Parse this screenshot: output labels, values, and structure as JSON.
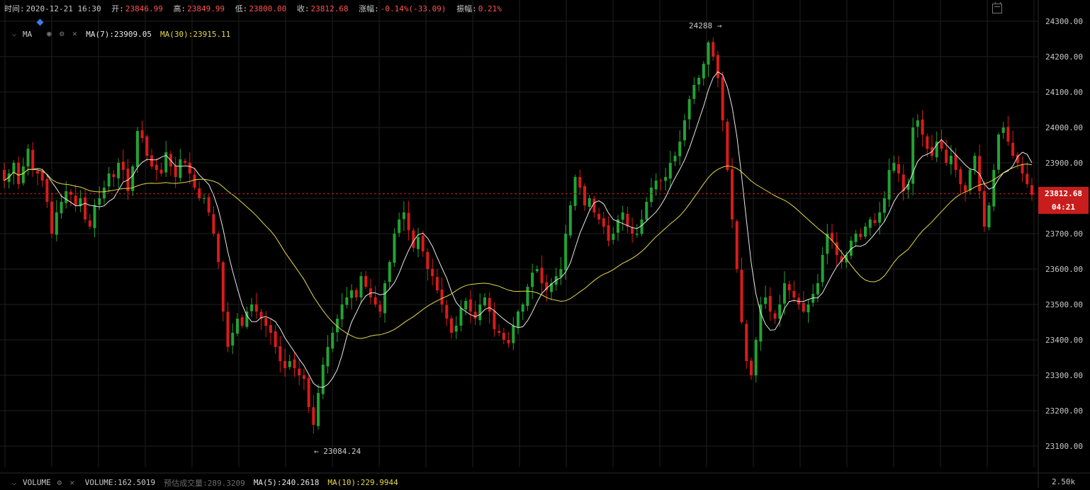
{
  "header": {
    "time_label": "时间:",
    "time_value": "2020-12-21 16:30",
    "open_label": "开:",
    "open_value": "23846.99",
    "high_label": "高:",
    "high_value": "23849.99",
    "low_label": "低:",
    "low_value": "23800.00",
    "close_label": "收:",
    "close_value": "23812.68",
    "change_label": "涨幅:",
    "change_value": "-0.14%(-33.09)",
    "amplitude_label": "振幅:",
    "amplitude_value": "0.21%"
  },
  "ma_indicator": {
    "name": "MA",
    "ma7_label": "MA(7):23909.05",
    "ma30_label": "MA(30):23915.11"
  },
  "volume_indicator": {
    "name": "VOLUME",
    "volume_label": "VOLUME:162.5019",
    "estimate_label": "预估成交量:289.3209",
    "ma5_label": "MA(5):240.2618",
    "ma10_label": "MA(10):229.9944"
  },
  "price_tag": {
    "price": "23812.68",
    "countdown": "04:21"
  },
  "annotations": {
    "high_marker": "24288 →",
    "low_marker": "← 23084.24"
  },
  "colors": {
    "up": "#21a334",
    "down": "#d91b1b",
    "ma7": "#e8e8e8",
    "ma30": "#e6d84a",
    "grid": "#1f1f1f",
    "last_price_line": "#c91d1d"
  },
  "icons": {
    "collapse": "chevron-down-icon",
    "visibility": "eye-icon",
    "settings": "gear-icon",
    "close": "close-icon",
    "calendar": "calendar-icon"
  },
  "chart_data": {
    "type": "candlestick",
    "y_axis_ticks": [
      "24300.00",
      "24200.00",
      "24100.00",
      "24000.00",
      "23900.00",
      "23800.00",
      "23700.00",
      "23600.00",
      "23500.00",
      "23400.00",
      "23300.00",
      "23200.00",
      "23100.00"
    ],
    "y_axis_values": [
      24300,
      24200,
      24100,
      24000,
      23900,
      23800,
      23700,
      23600,
      23500,
      23400,
      23300,
      23200,
      23100
    ],
    "volume_axis_tick": "2.50k",
    "ylim": [
      23047,
      24311
    ],
    "last_price": 23812.68,
    "closes": [
      23850,
      23870,
      23900,
      23840,
      23890,
      23940,
      23880,
      23870,
      23850,
      23790,
      23700,
      23760,
      23790,
      23820,
      23810,
      23780,
      23800,
      23740,
      23720,
      23780,
      23800,
      23830,
      23870,
      23860,
      23900,
      23880,
      23820,
      23890,
      23990,
      23970,
      23920,
      23890,
      23880,
      23870,
      23930,
      23890,
      23860,
      23910,
      23900,
      23870,
      23830,
      23800,
      23800,
      23760,
      23700,
      23620,
      23480,
      23380,
      23420,
      23460,
      23440,
      23480,
      23500,
      23480,
      23460,
      23440,
      23420,
      23380,
      23340,
      23320,
      23340,
      23320,
      23300,
      23290,
      23210,
      23160,
      23250,
      23330,
      23380,
      23420,
      23460,
      23500,
      23520,
      23540,
      23520,
      23580,
      23550,
      23520,
      23500,
      23480,
      23560,
      23620,
      23700,
      23740,
      23760,
      23710,
      23660,
      23690,
      23650,
      23600,
      23580,
      23540,
      23500,
      23460,
      23420,
      23440,
      23490,
      23510,
      23480,
      23460,
      23500,
      23520,
      23480,
      23430,
      23420,
      23400,
      23390,
      23440,
      23480,
      23500,
      23550,
      23590,
      23600,
      23560,
      23540,
      23560,
      23580,
      23600,
      23700,
      23780,
      23860,
      23830,
      23780,
      23800,
      23760,
      23740,
      23720,
      23680,
      23700,
      23740,
      23760,
      23720,
      23700,
      23700,
      23740,
      23790,
      23830,
      23850,
      23850,
      23860,
      23900,
      23920,
      23960,
      24020,
      24080,
      24120,
      24140,
      24180,
      24240,
      24200,
      24140,
      24020,
      23880,
      23740,
      23600,
      23450,
      23340,
      23300,
      23400,
      23500,
      23520,
      23480,
      23460,
      23500,
      23560,
      23540,
      23520,
      23500,
      23480,
      23500,
      23530,
      23560,
      23640,
      23700,
      23680,
      23640,
      23620,
      23640,
      23680,
      23700,
      23690,
      23720,
      23740,
      23730,
      23760,
      23800,
      23880,
      23900,
      23870,
      23820,
      23840,
      24000,
      24020,
      23980,
      23940,
      23920,
      23960,
      23940,
      23900,
      23920,
      23880,
      23840,
      23820,
      23880,
      23920,
      23820,
      23720,
      23780,
      23880,
      23980,
      24000,
      23960,
      23920,
      23900,
      23870,
      23840,
      23810
    ]
  }
}
